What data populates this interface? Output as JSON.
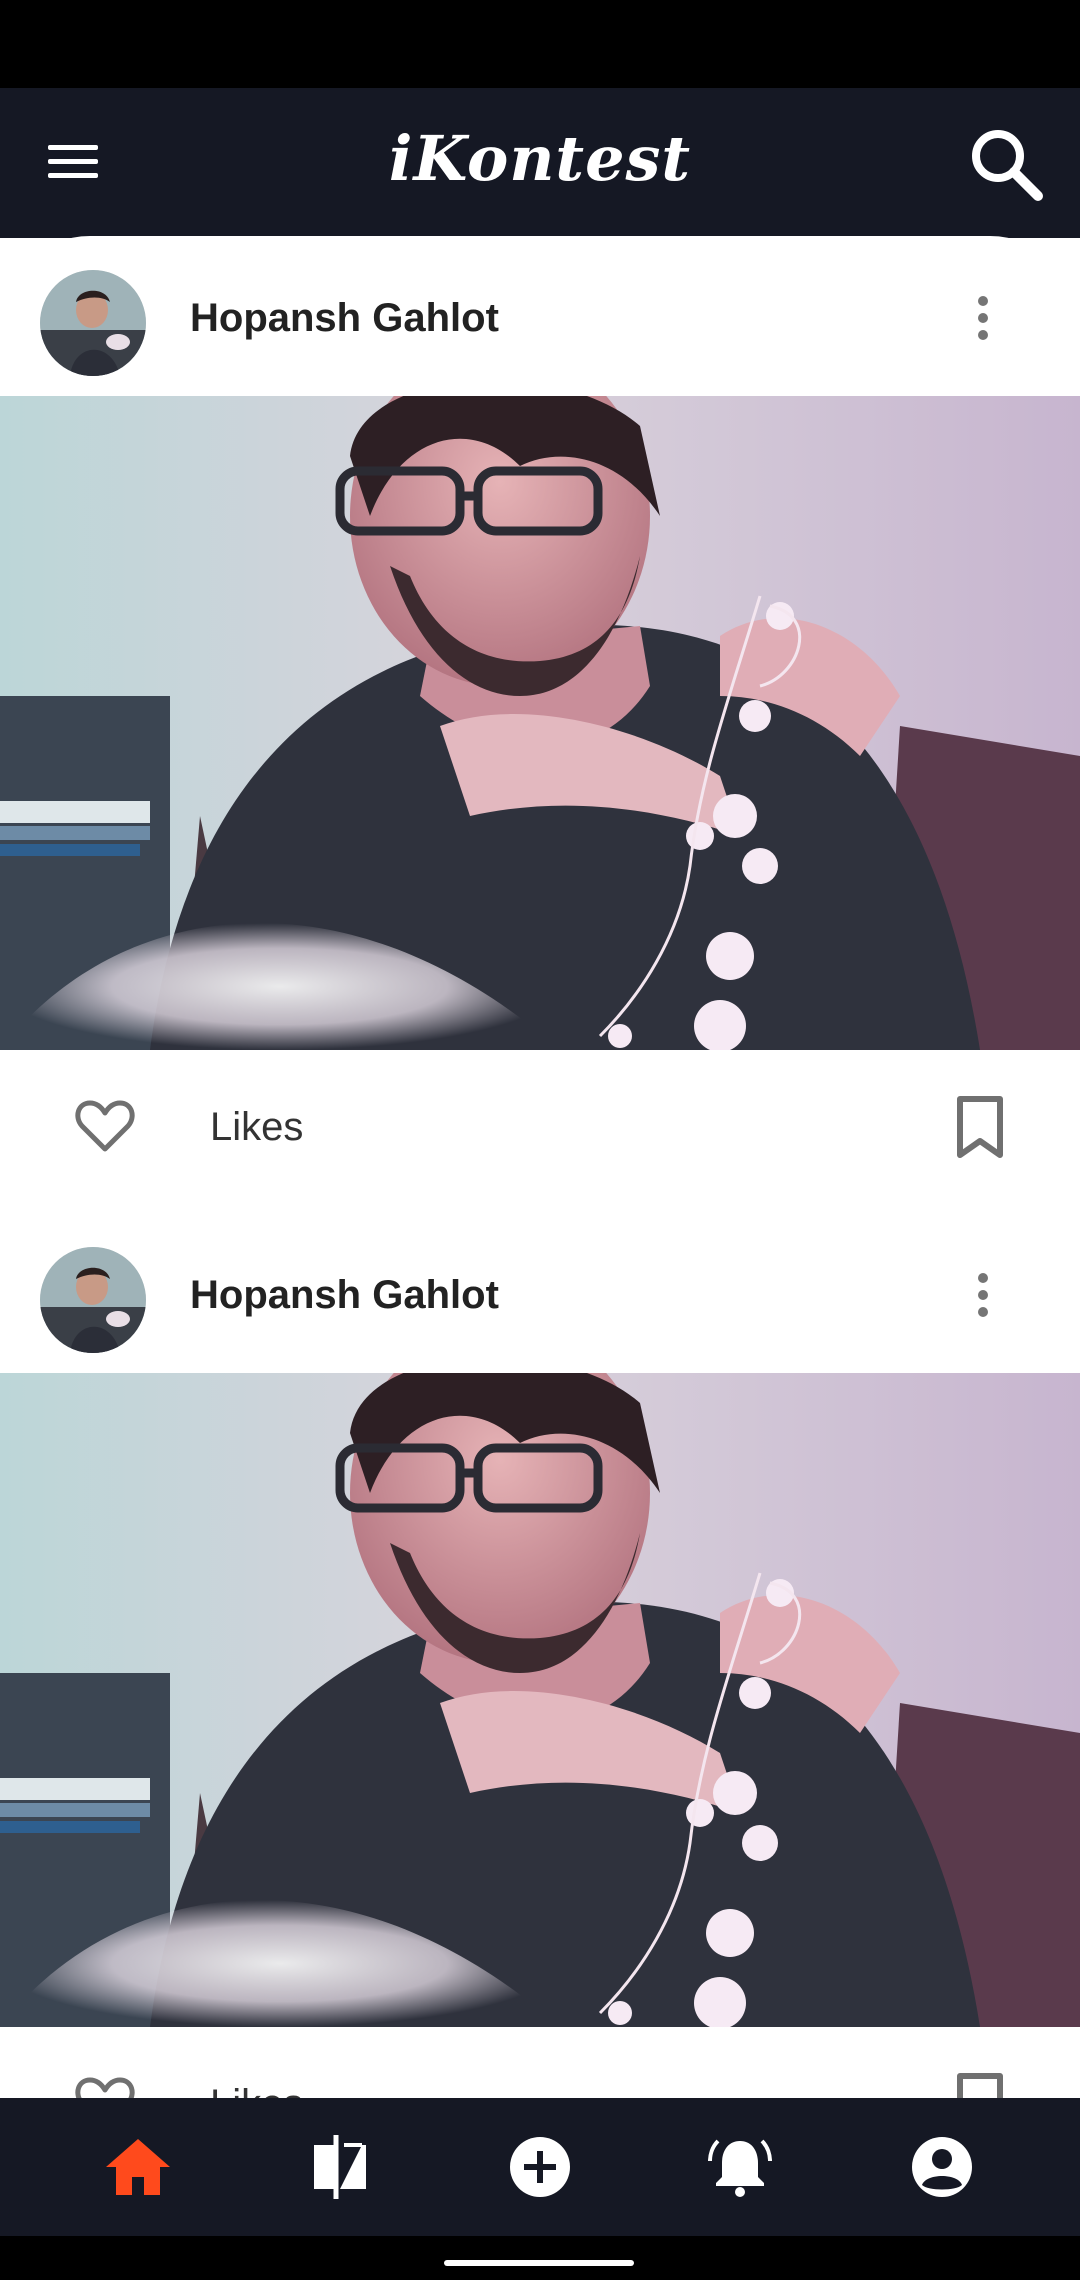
{
  "app": {
    "title": "iKontest",
    "accent_color": "#ff4a1c",
    "bar_color": "#151824"
  },
  "appbar": {
    "menu_icon": "hamburger-menu-icon",
    "search_icon": "search-icon"
  },
  "posts": [
    {
      "author": "Hopansh Gahlot",
      "likes_label": "Likes",
      "more_icon": "more-vertical-icon",
      "like_icon": "heart-outline-icon",
      "save_icon": "bookmark-outline-icon"
    },
    {
      "author": "Hopansh Gahlot",
      "likes_label": "Likes",
      "more_icon": "more-vertical-icon",
      "like_icon": "heart-outline-icon",
      "save_icon": "bookmark-outline-icon"
    }
  ],
  "bottom_nav": [
    {
      "icon": "home-icon",
      "active": true
    },
    {
      "icon": "compare-icon",
      "active": false
    },
    {
      "icon": "add-circle-icon",
      "active": false
    },
    {
      "icon": "notifications-active-icon",
      "active": false
    },
    {
      "icon": "account-circle-icon",
      "active": false
    }
  ]
}
